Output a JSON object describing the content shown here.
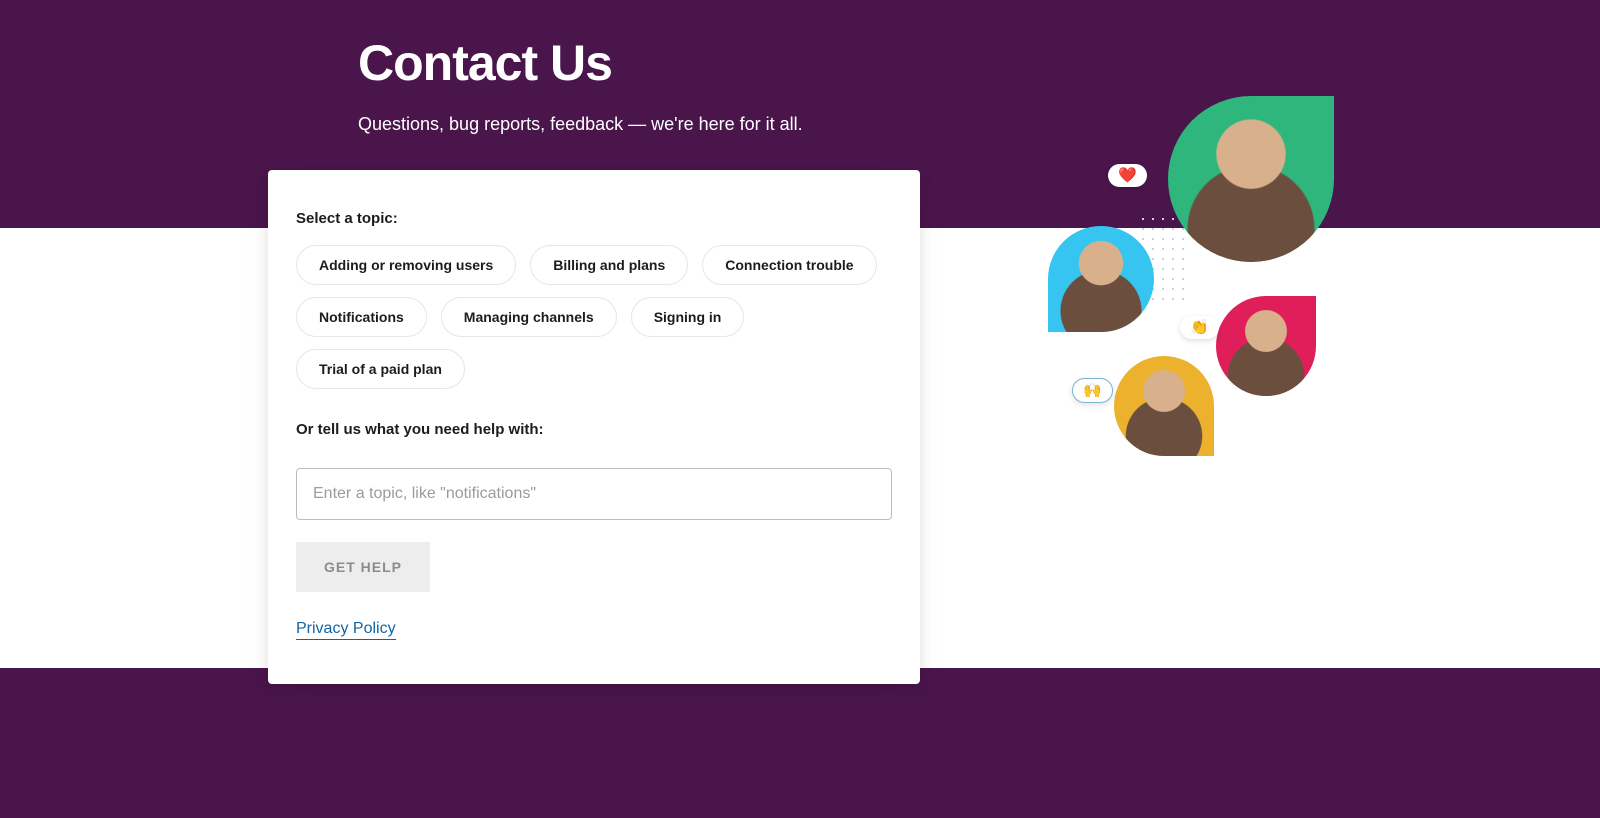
{
  "header": {
    "title": "Contact Us",
    "subtitle": "Questions, bug reports, feedback — we're here for it all."
  },
  "form": {
    "select_topic_label": "Select a topic:",
    "topics": [
      "Adding or removing users",
      "Billing and plans",
      "Connection trouble",
      "Notifications",
      "Managing channels",
      "Signing in",
      "Trial of a paid plan"
    ],
    "freeform_label": "Or tell us what you need help with:",
    "freeform_placeholder": "Enter a topic, like \"notifications\"",
    "submit_label": "GET HELP",
    "privacy_link": "Privacy Policy"
  },
  "illustration": {
    "emoji_heart": "❤️",
    "emoji_clap": "👏",
    "emoji_raise": "🙌"
  }
}
